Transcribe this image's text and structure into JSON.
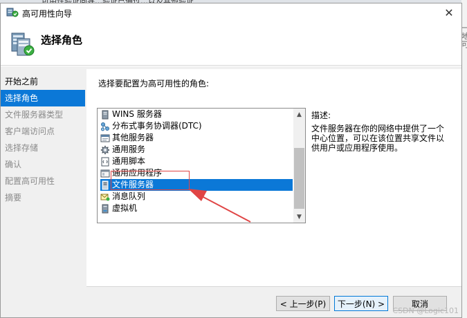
{
  "window": {
    "title": "高可用性向导",
    "close_glyph": "✕"
  },
  "header": {
    "title": "选择角色"
  },
  "steps": [
    {
      "label": "开始之前",
      "state": "done"
    },
    {
      "label": "选择角色",
      "state": "active"
    },
    {
      "label": "文件服务器类型",
      "state": "pending"
    },
    {
      "label": "客户端访问点",
      "state": "pending"
    },
    {
      "label": "选择存储",
      "state": "pending"
    },
    {
      "label": "确认",
      "state": "pending"
    },
    {
      "label": "配置高可用性",
      "state": "pending"
    },
    {
      "label": "摘要",
      "state": "pending"
    }
  ],
  "content": {
    "prompt": "选择要配置为高可用性的角色:",
    "roles": [
      {
        "label": "WINS 服务器",
        "icon": "server-icon",
        "selected": false
      },
      {
        "label": "分布式事务协调器(DTC)",
        "icon": "network-icon",
        "selected": false
      },
      {
        "label": "其他服务器",
        "icon": "window-icon",
        "selected": false
      },
      {
        "label": "通用服务",
        "icon": "gear-icon",
        "selected": false
      },
      {
        "label": "通用脚本",
        "icon": "script-icon",
        "selected": false
      },
      {
        "label": "通用应用程序",
        "icon": "application-icon",
        "selected": false
      },
      {
        "label": "文件服务器",
        "icon": "file-server-icon",
        "selected": true
      },
      {
        "label": "消息队列",
        "icon": "message-queue-icon",
        "selected": false
      },
      {
        "label": "虚拟机",
        "icon": "virtual-machine-icon",
        "selected": false
      }
    ],
    "description_label": "描述:",
    "description_text": "文件服务器在你的网络中提供了一个中心位置，可以在该位置共享文件以供用户或应用程序使用。"
  },
  "buttons": {
    "back": "< 上一步(P)",
    "next": "下一步(N) >",
    "cancel": "取消"
  },
  "background": {
    "top_strip_text": "可用性验证向导…验证已通过…以及其他验证",
    "right_edge_chars": [
      "一",
      "地",
      "可"
    ]
  },
  "watermark": "CSDN @Logic101",
  "colors": {
    "selection": "#0b78d7",
    "annotation": "#e04545"
  }
}
